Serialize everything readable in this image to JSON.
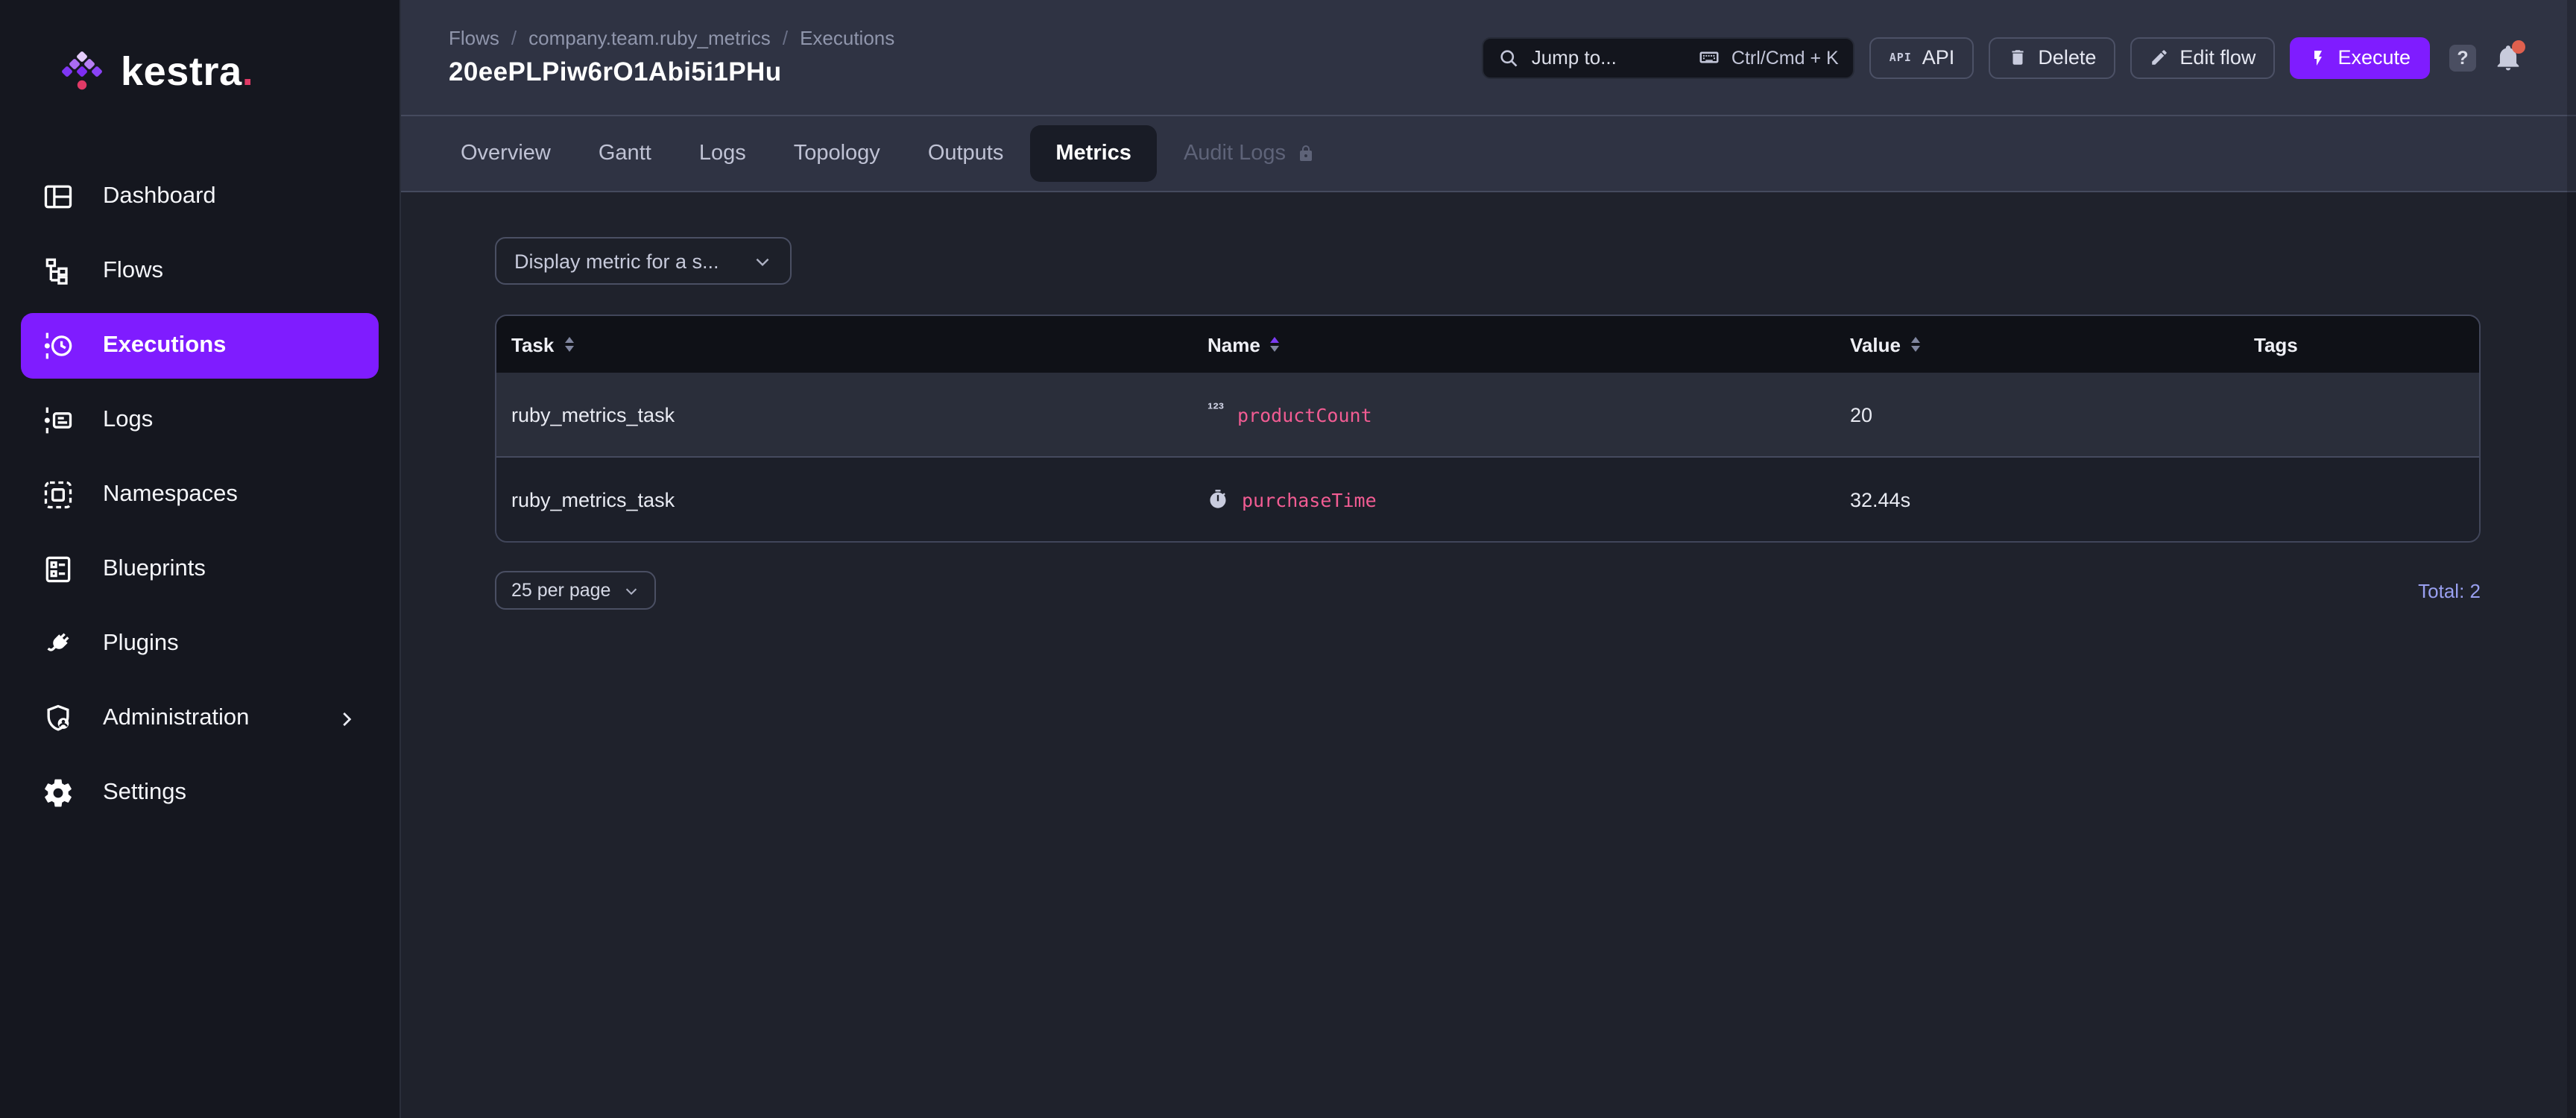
{
  "colors": {
    "accent_purple": "#7F1CFF",
    "metric_pink": "#F25C93",
    "total_link": "#99A0F0",
    "notification_dot": "#E0604E",
    "logo_dot_pink": "#E03A66",
    "sidebar_bg": "#15171F",
    "header_bg": "#2F3343",
    "content_bg": "#1F222C",
    "table_header_bg": "#0F1117"
  },
  "sidebar": {
    "logo_text": "kestra",
    "logo_suffix": ".",
    "items": [
      {
        "label": "Dashboard"
      },
      {
        "label": "Flows"
      },
      {
        "label": "Executions",
        "active": true
      },
      {
        "label": "Logs"
      },
      {
        "label": "Namespaces"
      },
      {
        "label": "Blueprints"
      },
      {
        "label": "Plugins"
      },
      {
        "label": "Administration",
        "has_submenu": true
      },
      {
        "label": "Settings"
      }
    ]
  },
  "header": {
    "breadcrumb": [
      "Flows",
      "company.team.ruby_metrics",
      "Executions"
    ],
    "breadcrumb_separator": "/",
    "title": "20eePLPiw6rO1Abi5i1PHu",
    "search": {
      "placeholder": "Jump to...",
      "shortcut": "Ctrl/Cmd + K"
    },
    "buttons": {
      "api_icon_text": "API",
      "api": "API",
      "delete": "Delete",
      "edit_flow": "Edit flow",
      "execute": "Execute",
      "help": "?"
    }
  },
  "tabs": [
    {
      "label": "Overview"
    },
    {
      "label": "Gantt"
    },
    {
      "label": "Logs"
    },
    {
      "label": "Topology"
    },
    {
      "label": "Outputs"
    },
    {
      "label": "Metrics",
      "active": true
    },
    {
      "label": "Audit Logs",
      "locked": true
    }
  ],
  "metrics_panel": {
    "metric_filter_placeholder": "Display metric for a s...",
    "table": {
      "columns": [
        {
          "label": "Task",
          "sortable": true
        },
        {
          "label": "Name",
          "sortable": true,
          "sorted": "asc"
        },
        {
          "label": "Value",
          "sortable": true
        },
        {
          "label": "Tags",
          "sortable": false
        }
      ],
      "rows": [
        {
          "task": "ruby_metrics_task",
          "metric_type": "counter",
          "icon": "numeric-icon",
          "icon_glyph": "¹²³",
          "name": "productCount",
          "value": "20",
          "tags": ""
        },
        {
          "task": "ruby_metrics_task",
          "metric_type": "timer",
          "icon": "timer-icon",
          "name": "purchaseTime",
          "value": "32.44s",
          "tags": ""
        }
      ]
    },
    "pagination": {
      "page_size": "25 per page",
      "total": "Total: 2"
    }
  }
}
